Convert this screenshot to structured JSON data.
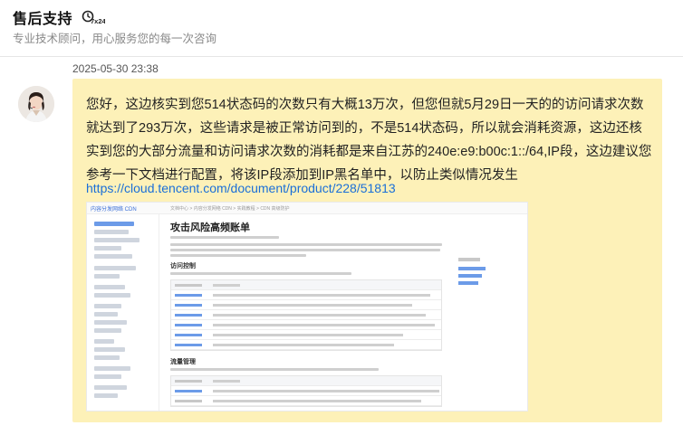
{
  "header": {
    "title": "售后支持",
    "badge_text": "7x24",
    "subtitle": "专业技术顾问，用心服务您的每一次咨询"
  },
  "message": {
    "timestamp": "2025-05-30 23:38",
    "text": "您好，这边核实到您514状态码的次数只有大概13万次，但您但就5月29日一天的的访问请求次数就达到了293万次，这些请求是被正常访问到的，不是514状态码，所以就会消耗资源，这边还核实到您的大部分流量和访问请求次数的消耗都是来自江苏的240e:e9:b00c:1::/64,IP段，这边建议您参考一下文档进行配置，将该IP段添加到IP黑名单中，以防止类似情况发生",
    "link": "https://cloud.tencent.com/document/product/228/51813"
  },
  "screenshot_preview": {
    "page_title": "攻击风险高频账单",
    "section_access": "访问控制",
    "section_traffic": "流量管理",
    "sidebar_brand": "内容分发网络 CDN",
    "breadcrumb": "文档中心 > 内容分发网络 CDN > 实践教程 > CDN 高级防护"
  },
  "colors": {
    "bubble": "#fdf1b8",
    "link": "#1a6fd8",
    "badge_icon": "#222222"
  }
}
